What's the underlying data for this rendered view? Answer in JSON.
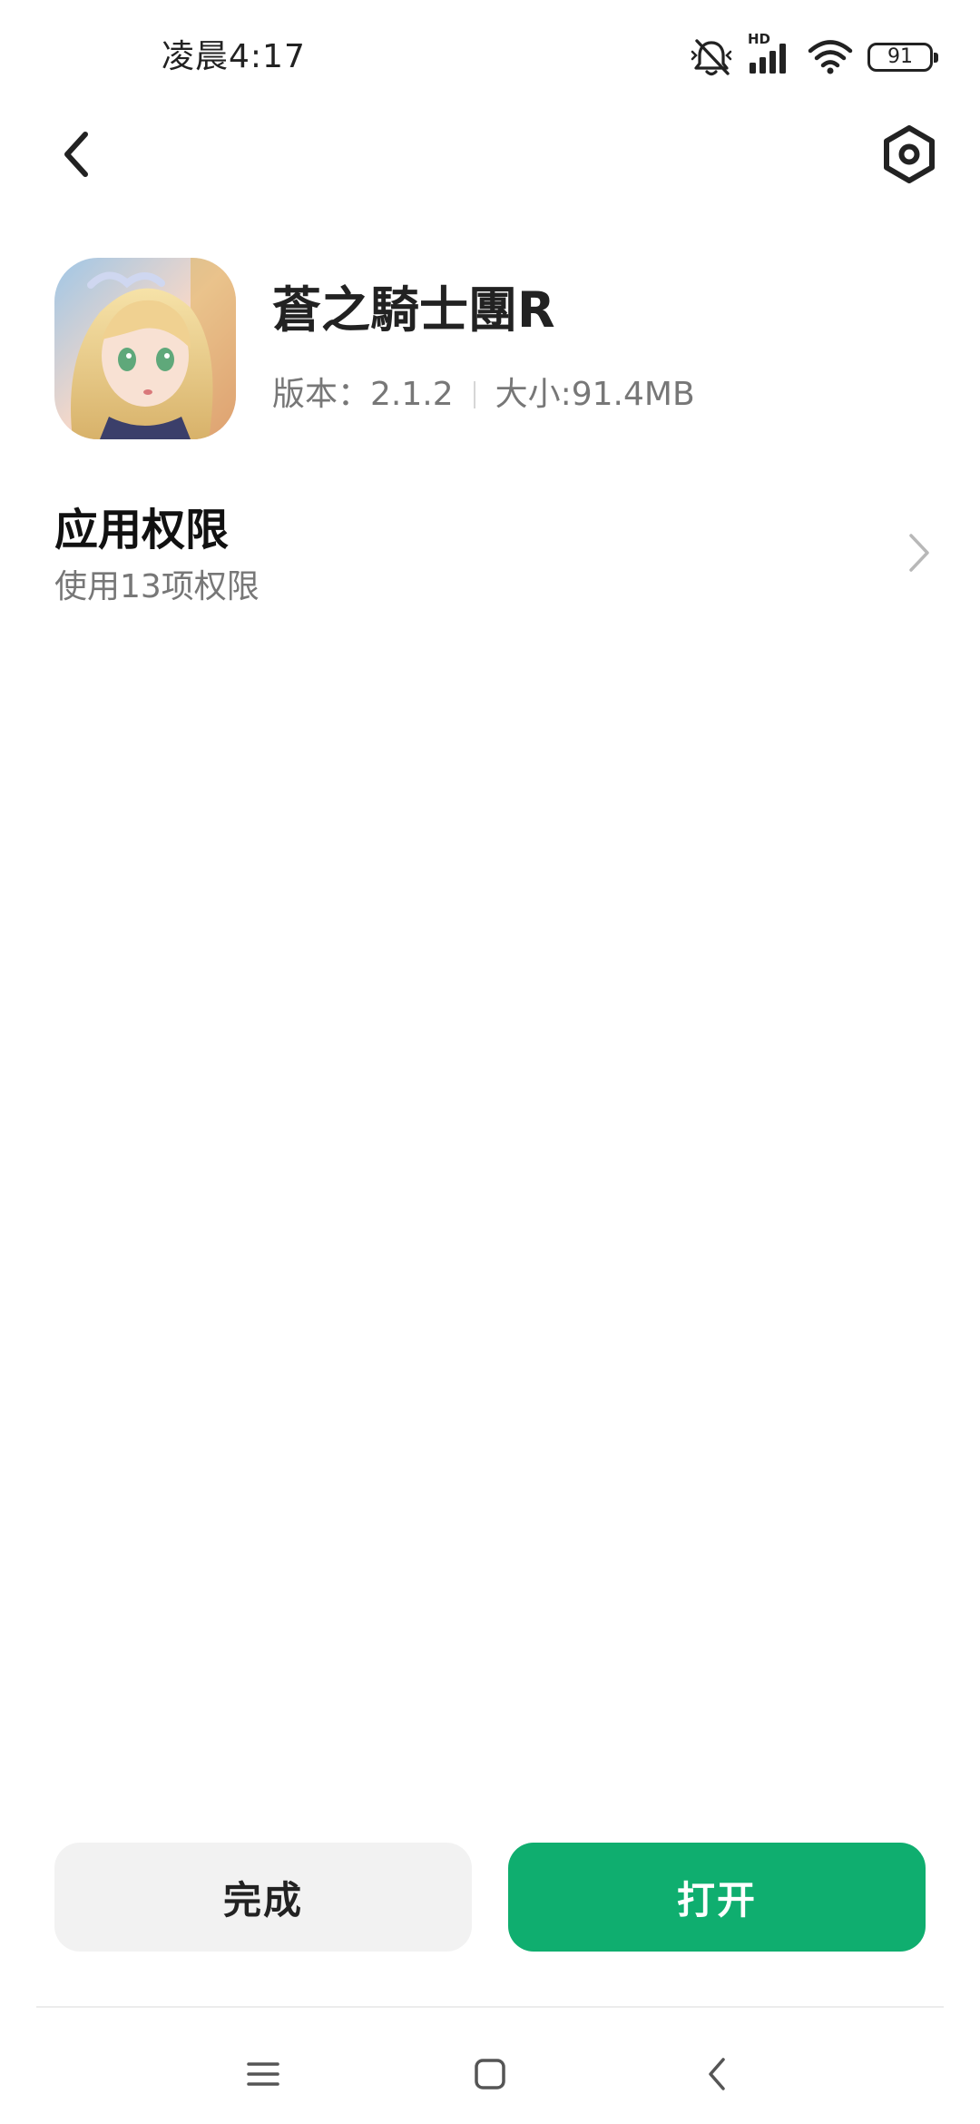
{
  "status_bar": {
    "time": "凌晨4:17",
    "battery_level": "91",
    "network_label": "HD",
    "icons": [
      "mute-icon",
      "signal-icon",
      "wifi-icon",
      "battery-icon"
    ]
  },
  "header": {
    "back_icon": "back-arrow-icon",
    "settings_icon": "settings-hexagon-icon"
  },
  "app": {
    "name": "蒼之騎士團R",
    "version": "版本：2.1.2",
    "size": "大小:91.4MB"
  },
  "permissions": {
    "title": "应用权限",
    "subtitle": "使用13项权限"
  },
  "actions": {
    "done_label": "完成",
    "open_label": "打开"
  },
  "colors": {
    "primary": "#0fae6f",
    "secondary_button": "#f2f2f2",
    "text_primary": "#111111",
    "text_secondary": "#777777"
  },
  "nav": {
    "icons": [
      "menu-icon",
      "home-icon",
      "back-icon"
    ]
  }
}
